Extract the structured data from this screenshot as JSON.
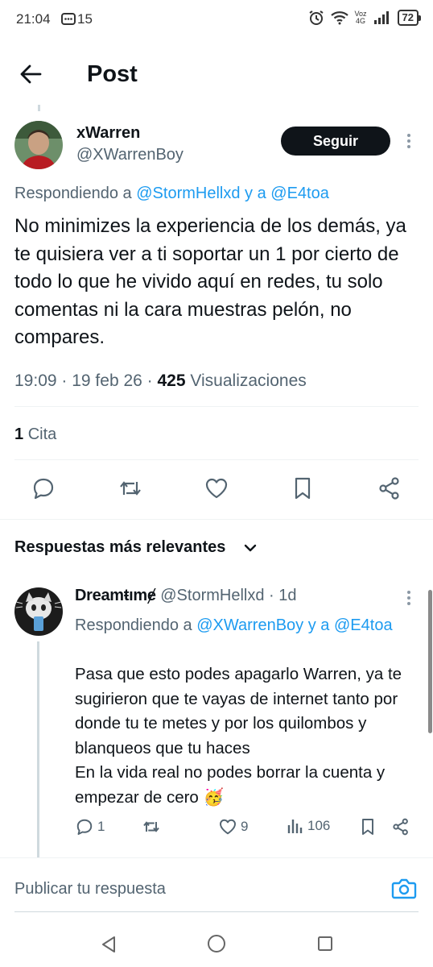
{
  "status_bar": {
    "time": "21:04",
    "notification_count": "15",
    "network_top": "Voz",
    "network_bottom": "4G",
    "battery": "72"
  },
  "header": {
    "title": "Post"
  },
  "post": {
    "display_name": "xWarren",
    "handle": "@XWarrenBoy",
    "follow_label": "Seguir",
    "replying_prefix": "Respondiendo a",
    "replying_mention_1": "@StormHellxd",
    "replying_join": "y a",
    "replying_mention_2": "@E4toa",
    "text": "No minimizes la experiencia de los demás, ya te quisiera ver a ti soportar un 1 por cierto de todo lo que he vivido aquí en redes, tu solo comentas ni la cara muestras pelón, no compares.",
    "time": "19:09",
    "date": "19 feb 26",
    "views_count": "425",
    "views_label": "Visualizaciones",
    "quote_count": "1",
    "quote_label": "Cita"
  },
  "replies_section": {
    "label": "Respuestas más relevantes"
  },
  "reply": {
    "display_name": "Dreamŧımɇ",
    "handle": "@StormHellxd",
    "date": "1d",
    "replying_prefix": "Respondiendo a",
    "replying_mention_1": "@XWarrenBoy",
    "replying_join": "y a",
    "replying_mention_2": "@E4toa",
    "text_line_1": "Pasa que esto podes apagarlo Warren, ya te sugirieron que te vayas de internet tanto por donde tu te metes y por los quilombos y blanqueos que tu haces",
    "text_line_2": "En la vida real no podes borrar la cuenta y empezar de cero 🥳",
    "reply_count": "1",
    "like_count": "9",
    "views_count": "106"
  },
  "composer": {
    "placeholder": "Publicar tu respuesta"
  },
  "colors": {
    "accent": "#1d9bf0",
    "text": "#0f1419",
    "secondary": "#536471",
    "divider": "#eff3f4"
  }
}
